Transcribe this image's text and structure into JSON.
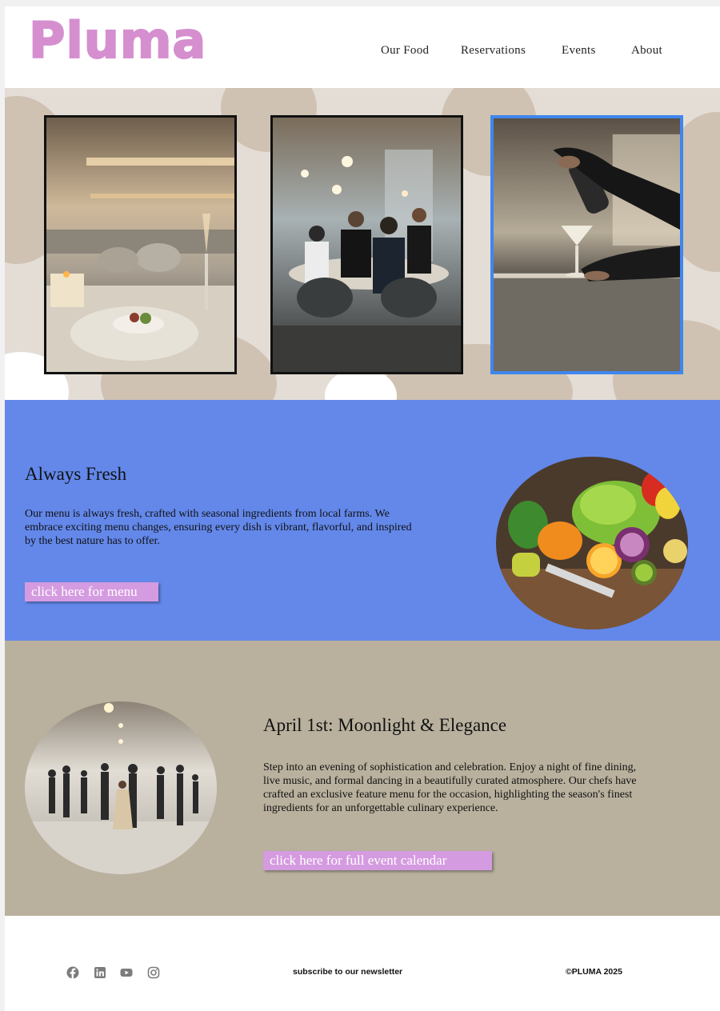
{
  "brand": {
    "logo": "Pluma",
    "color": "#d58fcf"
  },
  "nav": {
    "items": [
      "Our Food",
      "Reservations",
      "Events",
      "About"
    ]
  },
  "hero": {
    "photos": [
      "restaurant-table-photo",
      "diners-photo",
      "cocktail-bar-photo"
    ],
    "selected_photo": 2
  },
  "fresh": {
    "title": "Always Fresh",
    "body": "Our menu is always fresh, crafted with seasonal ingredients from local farms. We embrace exciting menu changes, ensuring every dish is vibrant, flavorful, and inspired by the best nature has to offer.",
    "button": "click here for menu",
    "background": "#6388ea"
  },
  "event": {
    "title": "April 1st: Moonlight & Elegance",
    "body": "Step into an evening of sophistication and celebration. Enjoy a night of fine dining, live music, and formal dancing in a beautifully curated atmosphere. Our chefs have crafted an exclusive feature menu for the occasion, highlighting the season's finest ingredients for an unforgettable culinary experience.",
    "button": "click here for full event calendar",
    "background": "#b9b19e"
  },
  "footer": {
    "social": [
      "facebook-icon",
      "linkedin-icon",
      "youtube-icon",
      "instagram-icon"
    ],
    "newsletter": "subscribe to our newsletter",
    "copyright": "©PLUMA 2025"
  },
  "colors": {
    "button": "#d59be0",
    "selection": "#3f86ee"
  }
}
